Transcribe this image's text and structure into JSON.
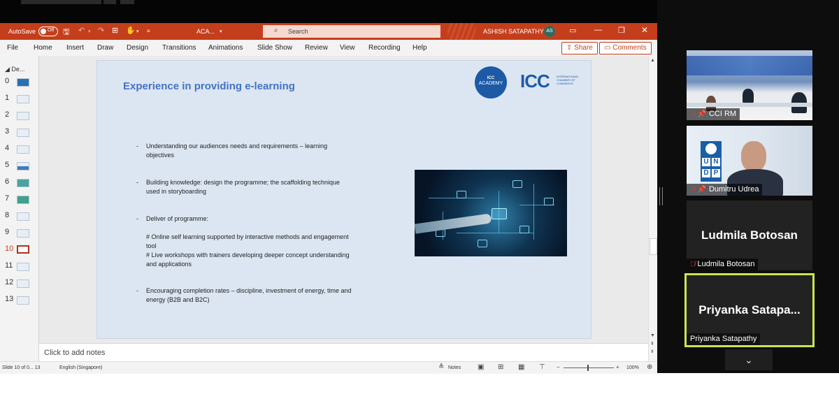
{
  "window": {
    "autosave_label": "AutoSave",
    "autosave_state": "Off",
    "doc_name": "ACA...",
    "search_placeholder": "Search",
    "user_name": "ASHISH SATAPATHY",
    "user_initials": "AS",
    "accent_color": "#c43e1c"
  },
  "menu": {
    "items": [
      "File",
      "Home",
      "Insert",
      "Draw",
      "Design",
      "Transitions",
      "Animations",
      "Slide Show",
      "Review",
      "View",
      "Recording",
      "Help"
    ],
    "share_label": "Share",
    "comments_label": "Comments"
  },
  "thumbnails": {
    "section_label": "De...",
    "numbers": [
      "0",
      "1",
      "2",
      "3",
      "4",
      "5",
      "6",
      "7",
      "8",
      "9",
      "10",
      "11",
      "12",
      "13"
    ],
    "active": "10"
  },
  "slide": {
    "title": "Experience in providing e-learning",
    "logo_academy_lines": [
      "ICC",
      "ACADEMY"
    ],
    "logo_icc": "ICC",
    "logo_icc_sub": "INTERNATIONAL CHAMBER OF COMMERCE",
    "bullets": [
      {
        "lines": [
          "Understanding our audiences needs and requirements – learning",
          "objectives"
        ]
      },
      {
        "lines": [
          " Building knowledge: design the programme; the scaffolding technique",
          "used in storyboarding"
        ]
      },
      {
        "lines": [
          "Deliver of programme:",
          "",
          "# Online self learning supported by interactive methods and engagement",
          "tool",
          "# Live workshops with trainers developing deeper concept understanding",
          "and applications"
        ]
      },
      {
        "lines": [
          " Encouraging completion rates – discipline, investment of energy, time and",
          "energy (B2B and B2C)"
        ]
      }
    ]
  },
  "notes": {
    "placeholder": "Click to add notes"
  },
  "status": {
    "slide_info": "Slide 10 of 0... 13",
    "language": "English (Singapore)",
    "notes_label": "Notes",
    "zoom": "100%"
  },
  "participants": [
    {
      "name": "CCI RM"
    },
    {
      "name": "Dumitru Udrea"
    },
    {
      "name": "Ludmila Botosan",
      "big_name": "Ludmila Botosan"
    },
    {
      "name": "Priyanka Satapathy",
      "big_name": "Priyanka  Satapa..."
    }
  ],
  "undp_letters": [
    "U",
    "N",
    "D",
    "P"
  ]
}
